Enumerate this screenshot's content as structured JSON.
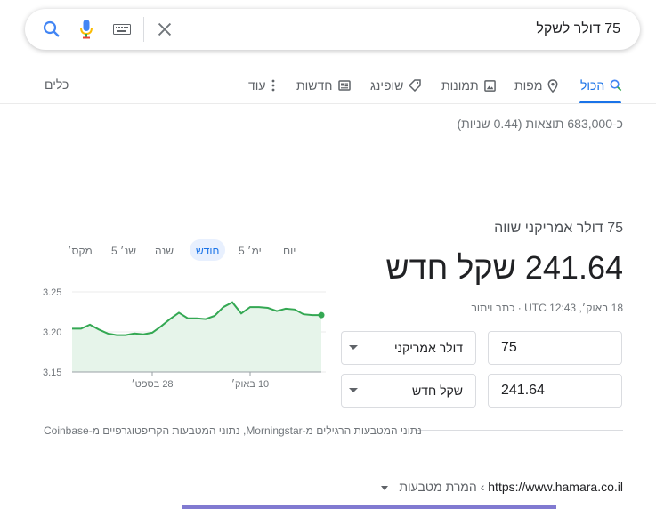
{
  "search": {
    "query": "75 דולר לשקל"
  },
  "tabs": [
    {
      "label": "הכול",
      "icon": "search-icon",
      "active": true
    },
    {
      "label": "מפות",
      "icon": "map-pin-icon"
    },
    {
      "label": "תמונות",
      "icon": "image-icon"
    },
    {
      "label": "שופינג",
      "icon": "tag-icon"
    },
    {
      "label": "חדשות",
      "icon": "news-icon"
    },
    {
      "label": "עוד",
      "icon": "more-vert-icon"
    }
  ],
  "tools_label": "כלים",
  "stats": "כ-683,000 תוצאות (0.44 שניות)",
  "converter": {
    "subtitle": "75 דולר אמריקני שווה",
    "result": "241.64 שקל חדש",
    "timestamp": "18 באוק׳, UTC 12:43 · כתב ויתור",
    "from_amount": "75",
    "from_currency": "דולר אמריקני",
    "to_amount": "241.64",
    "to_currency": "שקל חדש"
  },
  "chart_ranges": [
    "יום",
    "5 ימ׳",
    "חודש",
    "שנה",
    "5 שנ׳",
    "מקס׳"
  ],
  "chart_ranges_active": "חודש",
  "chart_data": {
    "type": "area",
    "x": [
      1,
      2,
      3,
      4,
      5,
      6,
      7,
      8,
      9,
      10,
      11,
      12,
      13,
      14,
      15,
      16,
      17,
      18,
      19,
      20,
      21,
      22,
      23,
      24,
      25,
      26,
      27,
      28,
      29
    ],
    "values": [
      3.204,
      3.204,
      3.209,
      3.203,
      3.198,
      3.196,
      3.196,
      3.198,
      3.197,
      3.199,
      3.207,
      3.216,
      3.224,
      3.217,
      3.217,
      3.216,
      3.22,
      3.231,
      3.237,
      3.223,
      3.231,
      3.231,
      3.23,
      3.226,
      3.229,
      3.228,
      3.222,
      3.221,
      3.221
    ],
    "yticks": [
      "3.25",
      "3.20",
      "3.15"
    ],
    "xticks": [
      "28 בספט׳",
      "10 באוק׳"
    ],
    "ylim": [
      3.15,
      3.25
    ],
    "line_color": "#34a853",
    "fill_color": "#e6f4ea"
  },
  "disclaimer": "נתוני המטבעות הרגילים מ-Morningstar, נתוני המטבעות הקריפטוגרפיים מ-Coinbase",
  "result": {
    "url": "https://www.hamara.co.il",
    "crumb": "המרת מטבעות"
  },
  "colors": {
    "accent": "#1a73e8",
    "chart_line": "#34a853"
  }
}
